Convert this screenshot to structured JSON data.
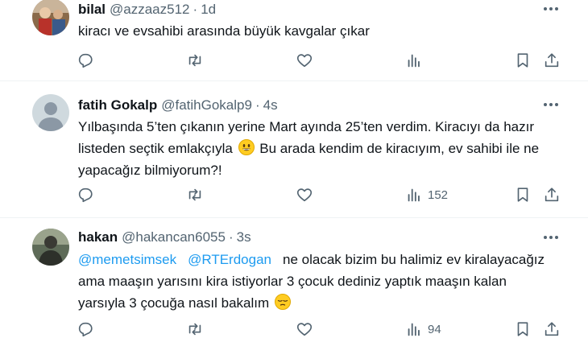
{
  "tweets": [
    {
      "name": "bilal",
      "handle": "@azzaaz512",
      "separator": "·",
      "time": "1d",
      "text": "kiracı ve  evsahibi arasında büyük kavgalar çıkar",
      "views": ""
    },
    {
      "name": "fatih Gokalp",
      "handle": "@fatihGokalp9",
      "separator": "·",
      "time": "4s",
      "lines": [
        "Yılbaşında 5’ten çıkanın yerine Mart ayında 25’ten verdim. Kiracıyı da hazır",
        "listeden seçtik emlakçıyla",
        "Bu arada kendim de kiracıyım, ev sahibi ile ne",
        "yapacağız bilmiyorum?!"
      ],
      "views": "152"
    },
    {
      "name": "hakan",
      "handle": "@hakancan6055",
      "separator": "·",
      "time": "3s",
      "mention1": "@memetsimsek",
      "mention2": "@RTErdogan",
      "lines": [
        "ne olacak bizim bu halimiz ev kiralayacağız",
        "ama maaşın yarısını kira istiyorlar 3 çocuk dediniz yaptık maaşın kalan",
        "yarsıyla 3 çocuğa nasıl bakalım"
      ],
      "views": "94"
    }
  ],
  "icons": {
    "reply": "reply-icon",
    "retweet": "retweet-icon",
    "like": "like-icon",
    "views": "views-icon",
    "bookmark": "bookmark-icon",
    "share": "share-icon",
    "more": "more-icon"
  },
  "colors": {
    "text": "#0f1419",
    "secondary": "#536471",
    "link": "#1d9bf0",
    "divider": "#eff3f4"
  }
}
